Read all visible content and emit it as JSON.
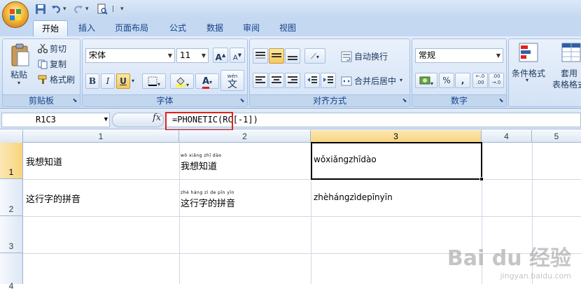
{
  "quick_access": [
    "save-icon",
    "undo-icon",
    "redo-icon",
    "print-preview-icon",
    "customize-icon"
  ],
  "tabs": [
    {
      "label": "开始",
      "active": true
    },
    {
      "label": "插入"
    },
    {
      "label": "页面布局"
    },
    {
      "label": "公式"
    },
    {
      "label": "数据"
    },
    {
      "label": "审阅"
    },
    {
      "label": "视图"
    }
  ],
  "ribbon": {
    "clipboard": {
      "group_label": "剪贴板",
      "paste": "粘贴",
      "cut": "剪切",
      "copy": "复制",
      "format_painter": "格式刷"
    },
    "font": {
      "group_label": "字体",
      "font_name": "宋体",
      "font_size": "11",
      "bold": "B",
      "italic": "I",
      "underline": "U",
      "grow": "A",
      "shrink": "A",
      "phonetic": "wén",
      "phonetic_char": "文"
    },
    "alignment": {
      "group_label": "对齐方式",
      "wrap_text": "自动换行",
      "merge_center": "合并后居中"
    },
    "number": {
      "group_label": "数字",
      "format": "常规",
      "percent": "%",
      "comma": ","
    },
    "styles": {
      "conditional": "条件格式",
      "table_format_1": "套用",
      "table_format_2": "表格格式"
    }
  },
  "formula_bar": {
    "name_box": "R1C3",
    "fx": "fx",
    "formula": "=PHONETIC(RC[-1])"
  },
  "columns": [
    "1",
    "2",
    "3",
    "4",
    "5"
  ],
  "rows": [
    "1",
    "2",
    "3",
    "4"
  ],
  "cells": {
    "r1c1": "我想知道",
    "r1c2_ruby": "wǒ xiǎng zhī dào",
    "r1c2": "我想知道",
    "r1c3": "wǒxiǎngzhīdào",
    "r2c1": "这行字的拼音",
    "r2c2_ruby": "zhè háng zì de pīn yīn",
    "r2c2": "这行字的拼音",
    "r2c3": "zhèhángzìdepīnyīn"
  },
  "watermark": {
    "brand": "Bai du 经验",
    "url": "jingyan.baidu.com"
  },
  "colors": {
    "accent_selection": "#000000",
    "highlight_box": "#e0211d",
    "active_header": "#f8d57c"
  }
}
